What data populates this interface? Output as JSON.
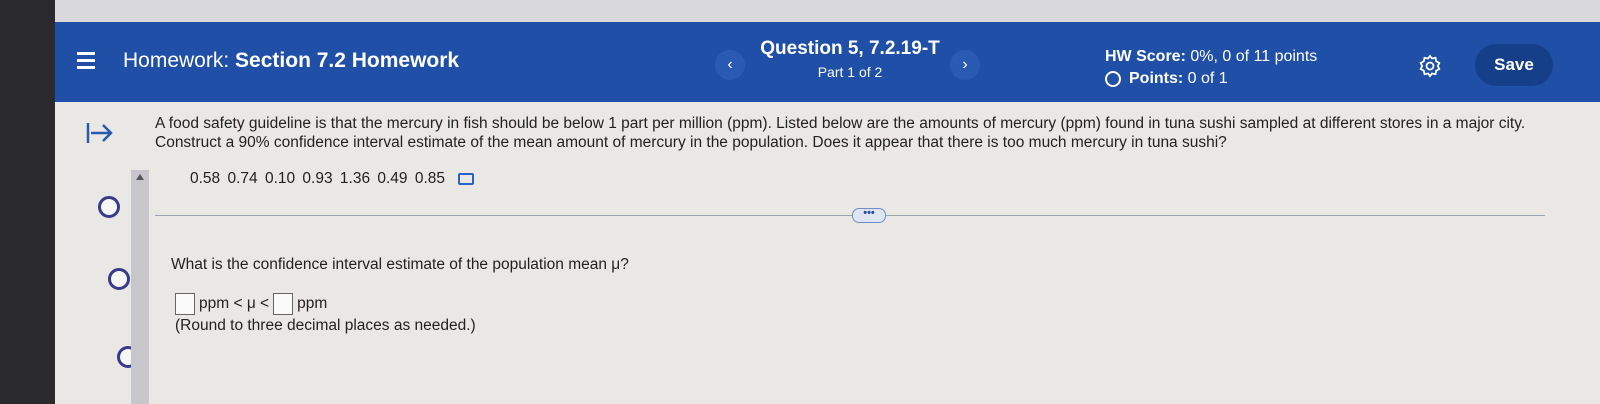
{
  "header": {
    "homework_prefix": "Homework:",
    "homework_title": "Section 7.2 Homework",
    "question_title": "Question 5, 7.2.19-T",
    "question_part": "Part 1 of 2",
    "hw_score_label": "HW Score:",
    "hw_score_value": "0%, 0 of 11 points",
    "points_label": "Points:",
    "points_value": "0 of 1",
    "prev_glyph": "‹",
    "next_glyph": "›",
    "save_label": "Save"
  },
  "problem": {
    "prompt": "A food safety guideline is that the mercury in fish should be below 1 part per million (ppm). Listed below are the amounts of mercury (ppm) found in tuna sushi sampled at different stores in a major city. Construct a 90% confidence interval estimate of the mean amount of mercury in the population. Does it appear that there is too much mercury in tuna sushi?",
    "data_values": "0.58  0.74  0.10  0.93  1.36  0.49  0.85",
    "more_label": "•••"
  },
  "part1": {
    "question": "What is the confidence interval estimate of the population mean μ?",
    "mid_text": "ppm < μ <",
    "end_text": "ppm",
    "hint": "(Round to three decimal places as needed.)"
  },
  "colors": {
    "header_bg": "#1f4fa6",
    "save_bg": "#163f8a",
    "page_bg": "#e9e8e4"
  }
}
